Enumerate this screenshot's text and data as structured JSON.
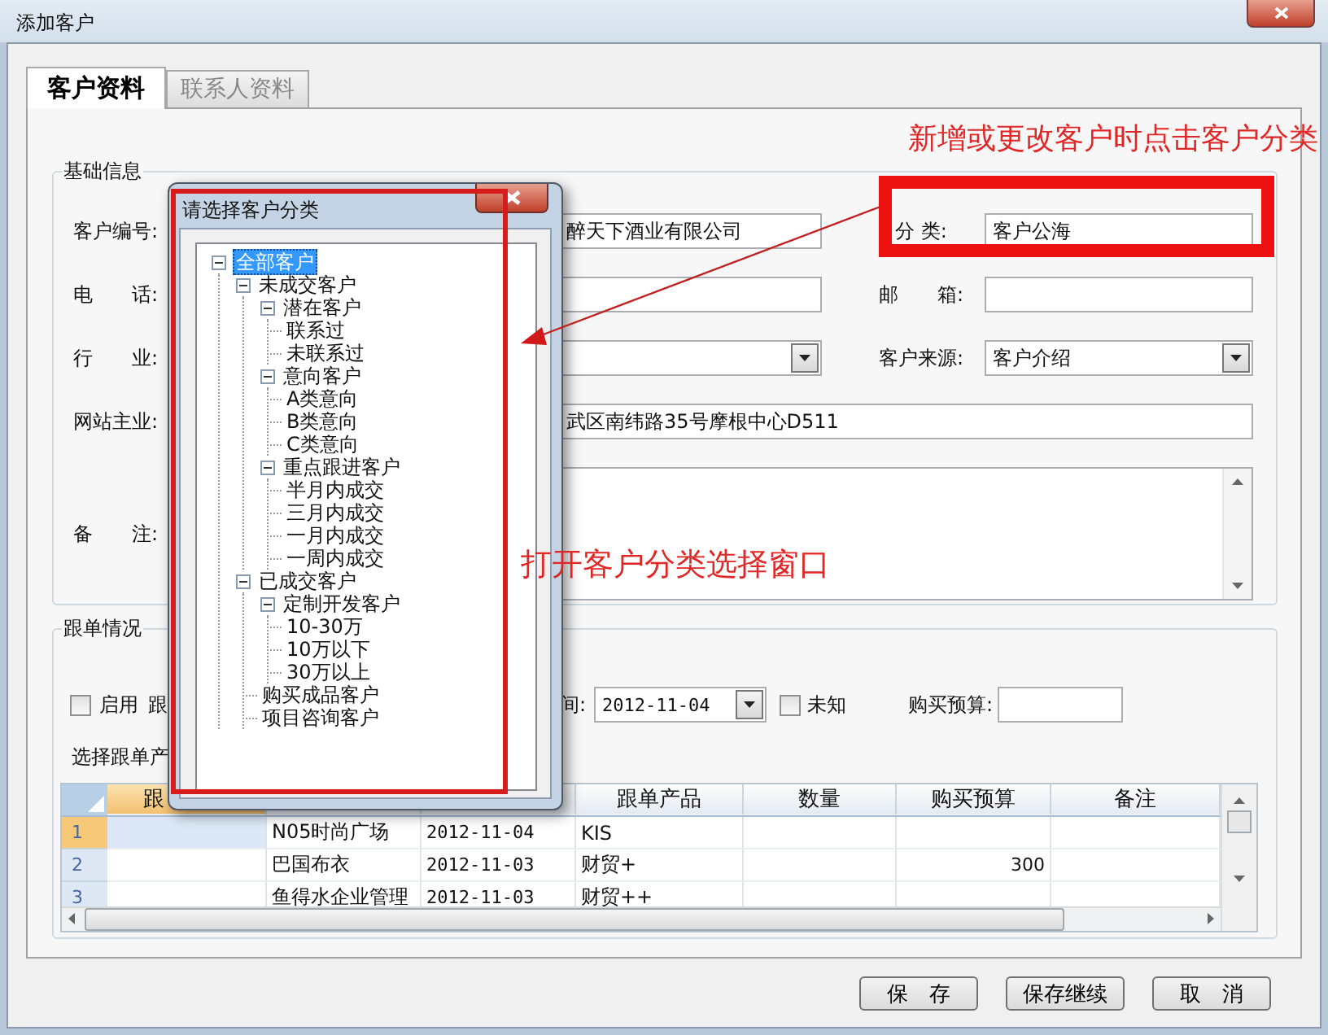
{
  "window": {
    "title": "添加客户"
  },
  "tabs": [
    {
      "label": "客户资料",
      "selected": true
    },
    {
      "label": "联系人资料",
      "selected": false
    }
  ],
  "basic_info": {
    "title": "基础信息",
    "rows": [
      {
        "left": {
          "label": "客户编号:",
          "kind": "text",
          "value": "醉天下酒业有限公司"
        },
        "right": {
          "label": "分 类:",
          "kind": "text",
          "value": "客户公海"
        }
      },
      {
        "left": {
          "label": "电　　话:",
          "kind": "text"
        },
        "right": {
          "label": "邮　　箱:",
          "kind": "text"
        }
      },
      {
        "left": {
          "label": "行　　业:",
          "kind": "dropdown"
        },
        "right": {
          "label": "客户来源:",
          "kind": "dropdown",
          "value": "客户介绍"
        }
      },
      {
        "wide": {
          "label": "网站主业:",
          "kind": "text",
          "value": "武区南纬路35号摩根中心D511"
        }
      },
      {
        "wide": {
          "label": "备　　注:",
          "kind": "textarea"
        }
      }
    ]
  },
  "follow_up": {
    "title": "跟单情况",
    "enable": {
      "label": "启用",
      "checked": false
    },
    "cut_label": "跟",
    "time_label": "间:",
    "date": {
      "value": "2012-11-04"
    },
    "unknown": {
      "label": "未知",
      "checked": false
    },
    "budget": {
      "label": "购买预算:"
    },
    "product_label": "选择跟单产",
    "table": {
      "columns": [
        {
          "label": "跟"
        },
        {},
        {},
        {
          "label": "跟单产品"
        },
        {
          "label": "数量"
        },
        {
          "label": "购买预算"
        },
        {
          "label": "备注"
        }
      ],
      "rows": [
        {
          "number": "1",
          "selected": true,
          "cells": [
            null,
            "N05时尚广场",
            "2012-11-04",
            "KIS",
            null,
            null,
            null
          ]
        },
        {
          "number": "2",
          "selected": false,
          "cells": [
            null,
            "巴国布衣",
            "2012-11-03",
            "财贸+",
            null,
            "300",
            null
          ]
        },
        {
          "number": "3",
          "selected": false,
          "cells": [
            null,
            "鱼得水企业管理",
            "2012-11-03",
            "财贸++",
            null,
            null,
            null
          ]
        }
      ]
    }
  },
  "buttons": [
    "保　存",
    "保存继续",
    "取　消"
  ],
  "dialog": {
    "title": "请选择客户分类",
    "tree": [
      {
        "label": "全部客户",
        "selected": true,
        "expanded": true,
        "children": [
          {
            "label": "未成交客户",
            "selected": false,
            "expanded": true,
            "children": [
              {
                "label": "潜在客户",
                "selected": false,
                "expanded": true,
                "children": [
                  {
                    "label": "联系过",
                    "selected": false
                  },
                  {
                    "label": "未联系过",
                    "selected": false
                  }
                ]
              },
              {
                "label": "意向客户",
                "selected": false,
                "expanded": true,
                "children": [
                  {
                    "label": "A类意向",
                    "selected": false
                  },
                  {
                    "label": "B类意向",
                    "selected": false
                  },
                  {
                    "label": "C类意向",
                    "selected": false
                  }
                ]
              },
              {
                "label": "重点跟进客户",
                "selected": false,
                "expanded": true,
                "children": [
                  {
                    "label": "半月内成交",
                    "selected": false
                  },
                  {
                    "label": "三月内成交",
                    "selected": false
                  },
                  {
                    "label": "一月内成交",
                    "selected": false
                  },
                  {
                    "label": "一周内成交",
                    "selected": false
                  }
                ]
              }
            ]
          },
          {
            "label": "已成交客户",
            "selected": false,
            "expanded": true,
            "children": [
              {
                "label": "定制开发客户",
                "selected": false,
                "expanded": true,
                "children": [
                  {
                    "label": "10-30万",
                    "selected": false
                  },
                  {
                    "label": "10万以下",
                    "selected": false
                  },
                  {
                    "label": "30万以上",
                    "selected": false
                  }
                ]
              },
              {
                "label": "购买成品客户",
                "selected": false
              },
              {
                "label": "项目咨询客户",
                "selected": false
              }
            ]
          }
        ]
      }
    ]
  },
  "annotations": [
    {
      "text": "新增或更改客户时点击客户分类"
    },
    {
      "text": "打开客户分类选择窗口"
    }
  ]
}
